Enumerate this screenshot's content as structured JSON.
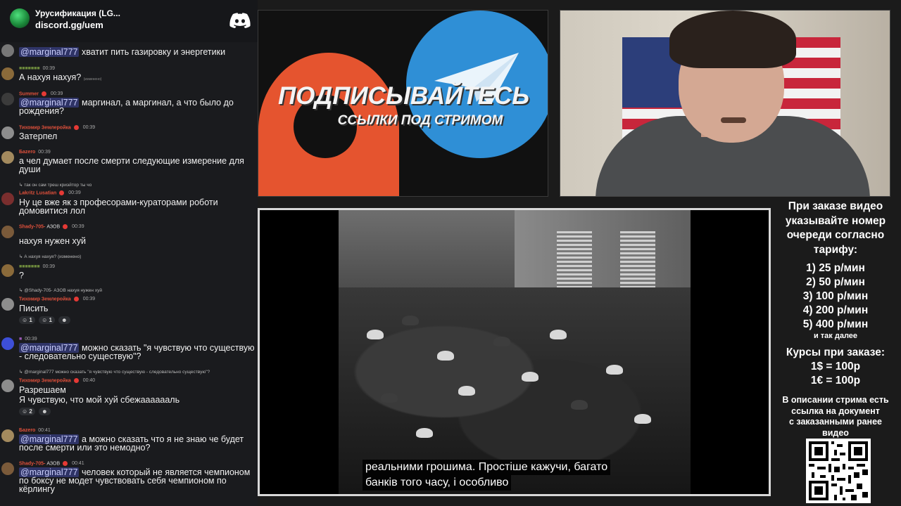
{
  "discord": {
    "server_name": "Урусификация (LG...",
    "invite": "discord.gg/uem"
  },
  "chat": [
    {
      "mention": "@marginal777",
      "text": "хватит пить газировку и энергетики",
      "user": "",
      "time": ""
    },
    {
      "user": "",
      "time": "00:39",
      "text": "А нахуя нахуя?",
      "note": "(изменено)",
      "user_color": "#6e8b3d"
    },
    {
      "user": "Summer",
      "time": "00:39",
      "mention": "@marginal777",
      "text": "маргинал, а маргинал, а что было до рождения?",
      "user_color": "#e0503b"
    },
    {
      "user": "Тихомир Землеройка",
      "time": "00:39",
      "text": "Затерпел",
      "user_color": "#e0503b"
    },
    {
      "user": "Бazero",
      "time": "00:39",
      "text": "а чел думает после смерти следующие измерение для души",
      "user_color": "#e0503b"
    },
    {
      "reply": "так он сам треш криэйтор ты чо",
      "user": "Lakritz Lusatian",
      "time": "00:39",
      "text": "Ну це вже як з професорами-кураторами роботи домовитися лол",
      "user_color": "#e0503b"
    },
    {
      "user": "Shady-705-",
      "tag": "АЗОВ",
      "time": "00:39",
      "text": "нахуя нужен хуй",
      "user_color": "#e0503b"
    },
    {
      "reply": "А нахуя нахуя?",
      "reply_note": "(изменено)",
      "time": "00:39",
      "text": "?",
      "user": "",
      "user_color": "#6e8b3d"
    },
    {
      "reply": "@Shady-705- АЗОВ нахуя нужен хуй",
      "user": "Тихомир Землеройка",
      "time": "00:39",
      "text": "Писить",
      "reactions": [
        "1",
        "1"
      ],
      "user_color": "#e0503b"
    },
    {
      "user": "",
      "time": "00:39",
      "mention": "@marginal777",
      "text": "можно сказать \"я чувствую что существую - следовательно существую\"?",
      "user_color": "#9b59b6"
    },
    {
      "reply": "@marginal777 можно сказать \"я чувствую что существую - следовательно существую\"?",
      "user": "Тихомир Землеройка",
      "time": "00:40",
      "text": "Разрешаем",
      "text2": "Я чувствую, что мой хуй сбежааааааль",
      "reactions": [
        "2"
      ],
      "user_color": "#e0503b"
    },
    {
      "user": "Бazero",
      "time": "00:41",
      "mention": "@marginal777",
      "text": "а можно сказать что я не знаю че будет после смерти или это немодно?",
      "user_color": "#e0503b"
    },
    {
      "user": "Shady-705-",
      "tag": "АЗОВ",
      "time": "00:41",
      "mention": "@marginal777",
      "text": "человек который не является чемпионом по боксу не модет чувствовать себя чемпионом по кёрлингу",
      "user_color": "#e0503b"
    }
  ],
  "promo": {
    "title": "ПОДПИСЫВАЙТЕСЬ",
    "subtitle": "ССЫЛКИ ПОД СТРИМОМ",
    "colors": {
      "patreon": "#e5542f",
      "telegram": "#2f8fd6"
    }
  },
  "video": {
    "subtitle_line1": "реальними грошима.  Простіше кажучи, багато",
    "subtitle_line2": "банків того часу, і особливо"
  },
  "prices": {
    "intro": [
      "При заказе видео",
      "указывайте номер",
      "очереди согласно",
      "тарифу:"
    ],
    "tariffs": [
      "1) 25 р/мин",
      "2) 50 р/мин",
      "3) 100 р/мин",
      "4) 200 р/мин",
      "5) 400 р/мин"
    ],
    "etc": "и так далее",
    "rates_title": "Курсы при заказе:",
    "rates": [
      "1$ = 100р",
      "1€ = 100р"
    ],
    "description": [
      "В описании стрима есть",
      "ссылка на документ",
      "с заказанными ранее",
      "видео"
    ]
  }
}
